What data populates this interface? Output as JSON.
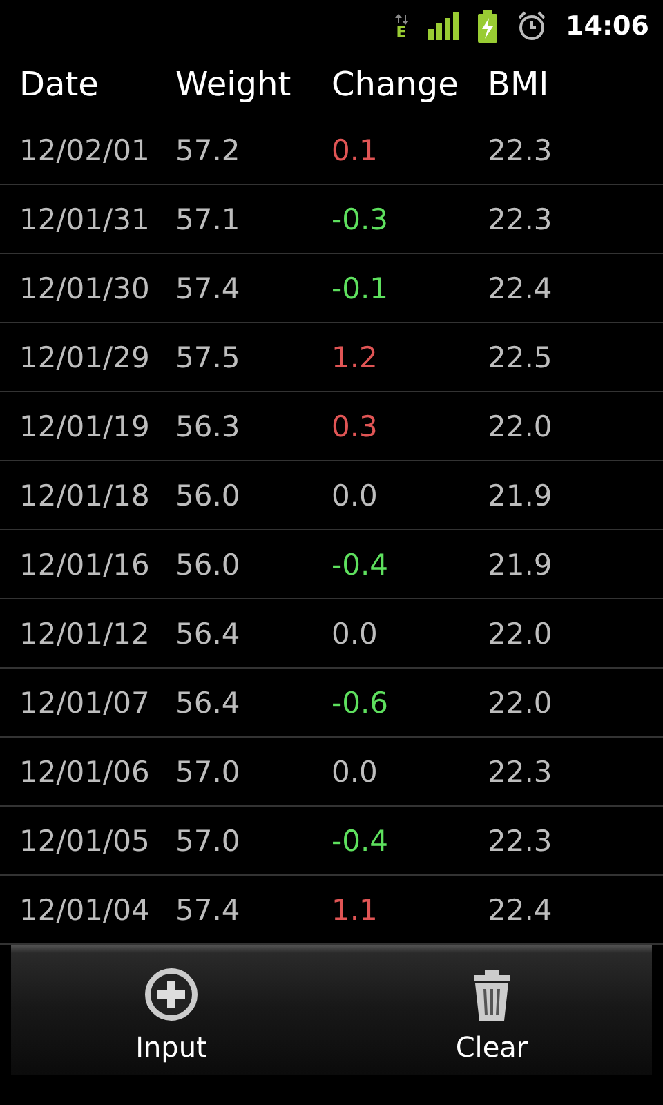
{
  "status_bar": {
    "time": "14:06",
    "network": "E"
  },
  "table": {
    "columns": [
      "Date",
      "Weight",
      "Change",
      "BMI"
    ],
    "rows": [
      {
        "date": "12/02/01",
        "weight": "57.2",
        "change": "0.1",
        "bmi": "22.3",
        "kind": "gain"
      },
      {
        "date": "12/01/31",
        "weight": "57.1",
        "change": "-0.3",
        "bmi": "22.3",
        "kind": "loss"
      },
      {
        "date": "12/01/30",
        "weight": "57.4",
        "change": "-0.1",
        "bmi": "22.4",
        "kind": "loss"
      },
      {
        "date": "12/01/29",
        "weight": "57.5",
        "change": "1.2",
        "bmi": "22.5",
        "kind": "gain"
      },
      {
        "date": "12/01/19",
        "weight": "56.3",
        "change": "0.3",
        "bmi": "22.0",
        "kind": "gain"
      },
      {
        "date": "12/01/18",
        "weight": "56.0",
        "change": "0.0",
        "bmi": "21.9",
        "kind": "none"
      },
      {
        "date": "12/01/16",
        "weight": "56.0",
        "change": "-0.4",
        "bmi": "21.9",
        "kind": "loss"
      },
      {
        "date": "12/01/12",
        "weight": "56.4",
        "change": "0.0",
        "bmi": "22.0",
        "kind": "none"
      },
      {
        "date": "12/01/07",
        "weight": "56.4",
        "change": "-0.6",
        "bmi": "22.0",
        "kind": "loss"
      },
      {
        "date": "12/01/06",
        "weight": "57.0",
        "change": "0.0",
        "bmi": "22.3",
        "kind": "none"
      },
      {
        "date": "12/01/05",
        "weight": "57.0",
        "change": "-0.4",
        "bmi": "22.3",
        "kind": "loss"
      },
      {
        "date": "12/01/04",
        "weight": "57.4",
        "change": "1.1",
        "bmi": "22.4",
        "kind": "gain"
      }
    ]
  },
  "toolbar": [
    {
      "label": "Input",
      "kind": "add"
    },
    {
      "label": "Clear",
      "kind": "delete"
    }
  ]
}
